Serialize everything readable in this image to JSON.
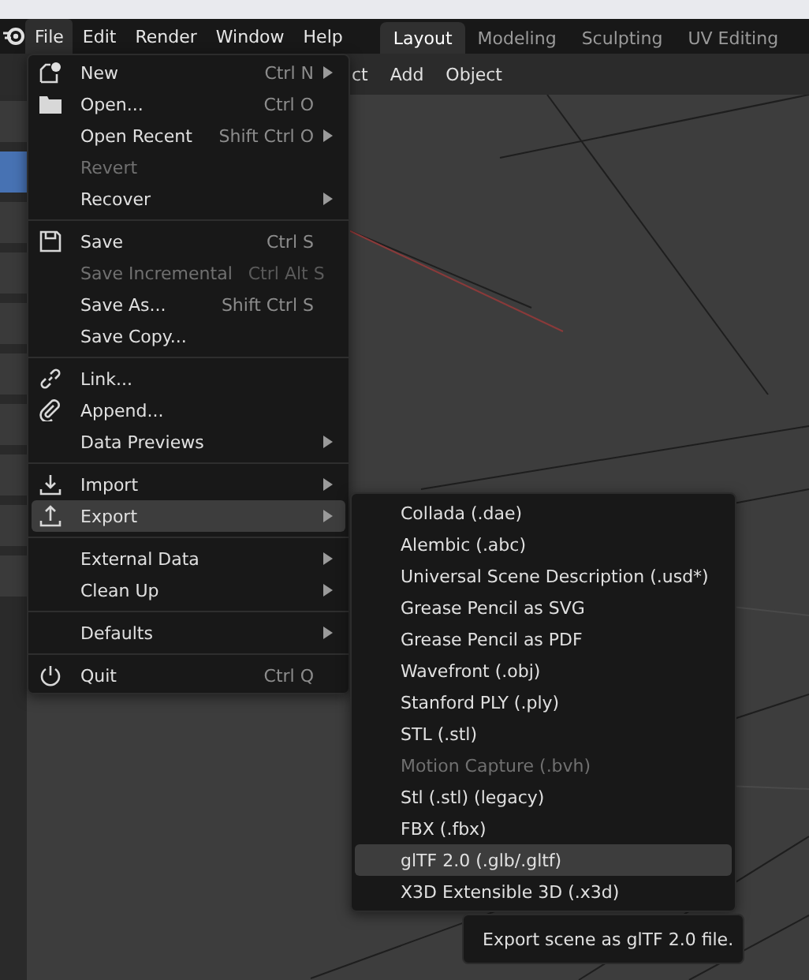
{
  "menu_bar": [
    {
      "label": "File",
      "selected": true
    },
    {
      "label": "Edit",
      "selected": false
    },
    {
      "label": "Render",
      "selected": false
    },
    {
      "label": "Window",
      "selected": false
    },
    {
      "label": "Help",
      "selected": false
    }
  ],
  "workspace_tabs": [
    {
      "label": "Layout",
      "selected": true
    },
    {
      "label": "Modeling",
      "selected": false
    },
    {
      "label": "Sculpting",
      "selected": false
    },
    {
      "label": "UV Editing",
      "selected": false
    }
  ],
  "header_menus": [
    "ct",
    "Add",
    "Object"
  ],
  "file_menu": {
    "sections": [
      [
        {
          "label": "New",
          "shortcut": "Ctrl N",
          "submenu": true,
          "disabled": false,
          "selected": false
        },
        {
          "label": "Open...",
          "shortcut": "Ctrl O",
          "submenu": false,
          "disabled": false,
          "selected": false
        },
        {
          "label": "Open Recent",
          "shortcut": "Shift Ctrl O",
          "submenu": true,
          "disabled": false,
          "selected": false
        },
        {
          "label": "Revert",
          "submenu": false,
          "disabled": true,
          "selected": false
        },
        {
          "label": "Recover",
          "submenu": true,
          "disabled": false,
          "selected": false
        }
      ],
      [
        {
          "label": "Save",
          "shortcut": "Ctrl S",
          "submenu": false,
          "disabled": false,
          "selected": false
        },
        {
          "label": "Save Incremental",
          "shortcut": "Ctrl Alt S",
          "submenu": false,
          "disabled": true,
          "selected": false
        },
        {
          "label": "Save As...",
          "shortcut": "Shift Ctrl S",
          "submenu": false,
          "disabled": false,
          "selected": false
        },
        {
          "label": "Save Copy...",
          "submenu": false,
          "disabled": false,
          "selected": false
        }
      ],
      [
        {
          "label": "Link...",
          "submenu": false,
          "disabled": false,
          "selected": false
        },
        {
          "label": "Append...",
          "submenu": false,
          "disabled": false,
          "selected": false
        },
        {
          "label": "Data Previews",
          "submenu": true,
          "disabled": false,
          "selected": false
        }
      ],
      [
        {
          "label": "Import",
          "submenu": true,
          "disabled": false,
          "selected": false
        },
        {
          "label": "Export",
          "submenu": true,
          "disabled": false,
          "selected": true
        }
      ],
      [
        {
          "label": "External Data",
          "submenu": true,
          "disabled": false,
          "selected": false
        },
        {
          "label": "Clean Up",
          "submenu": true,
          "disabled": false,
          "selected": false
        }
      ],
      [
        {
          "label": "Defaults",
          "submenu": true,
          "disabled": false,
          "selected": false
        }
      ],
      [
        {
          "label": "Quit",
          "shortcut": "Ctrl Q",
          "submenu": false,
          "disabled": false,
          "selected": false
        }
      ]
    ]
  },
  "export_menu": [
    {
      "label": "Collada (.dae)",
      "disabled": false,
      "selected": false
    },
    {
      "label": "Alembic (.abc)",
      "disabled": false,
      "selected": false
    },
    {
      "label": "Universal Scene Description (.usd*)",
      "disabled": false,
      "selected": false
    },
    {
      "label": "Grease Pencil as SVG",
      "disabled": false,
      "selected": false
    },
    {
      "label": "Grease Pencil as PDF",
      "disabled": false,
      "selected": false
    },
    {
      "label": "Wavefront (.obj)",
      "disabled": false,
      "selected": false
    },
    {
      "label": "Stanford PLY (.ply)",
      "disabled": false,
      "selected": false
    },
    {
      "label": "STL (.stl)",
      "disabled": false,
      "selected": false
    },
    {
      "label": "Motion Capture (.bvh)",
      "disabled": true,
      "selected": false
    },
    {
      "label": "Stl (.stl) (legacy)",
      "disabled": false,
      "selected": false
    },
    {
      "label": "FBX (.fbx)",
      "disabled": false,
      "selected": false
    },
    {
      "label": "glTF 2.0 (.glb/.gltf)",
      "disabled": false,
      "selected": true
    },
    {
      "label": "X3D Extensible 3D (.x3d)",
      "disabled": false,
      "selected": false
    }
  ],
  "tooltip": "Export scene as glTF 2.0 file."
}
